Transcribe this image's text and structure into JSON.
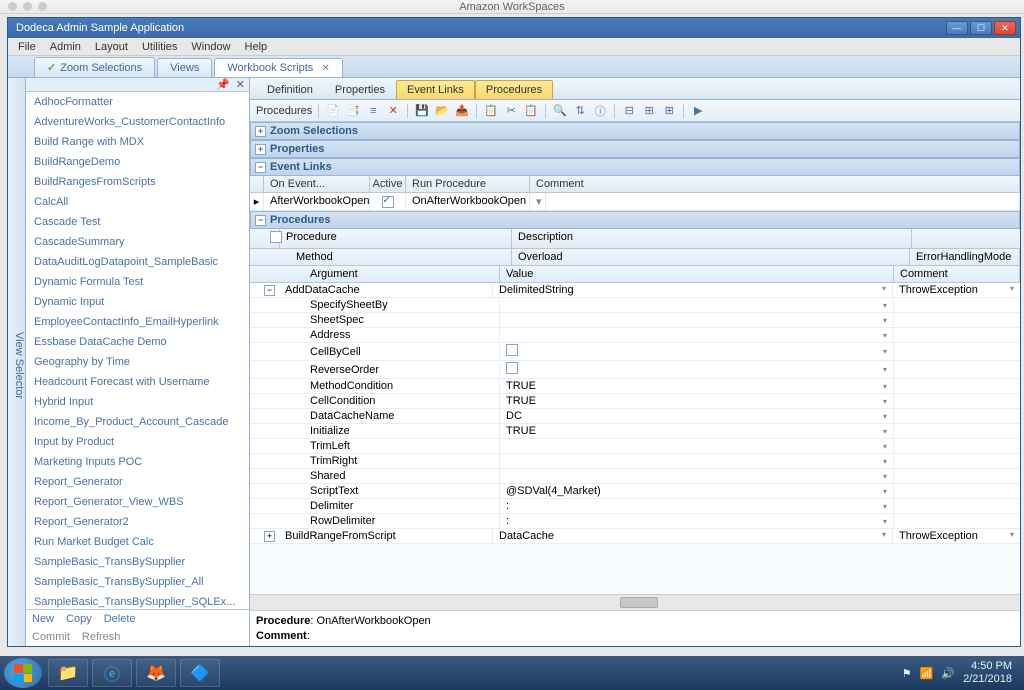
{
  "mac_title": "Amazon WorkSpaces",
  "app_title": "Dodeca Admin Sample Application",
  "menu": [
    "File",
    "Admin",
    "Layout",
    "Utilities",
    "Window",
    "Help"
  ],
  "tabs": [
    {
      "label": "Zoom Selections",
      "check": true
    },
    {
      "label": "Views"
    },
    {
      "label": "Workbook Scripts",
      "active": true,
      "closable": true
    }
  ],
  "view_selector_label": "View Selector",
  "left_list": [
    "AdhocFormatter",
    "AdventureWorks_CustomerContactInfo",
    "Build Range with MDX",
    "BuildRangeDemo",
    "BuildRangesFromScripts",
    "CalcAll",
    "Cascade Test",
    "CascadeSummary",
    "DataAuditLogDatapoint_SampleBasic",
    "Dynamic Formula Test",
    "Dynamic Input",
    "EmployeeContactInfo_EmailHyperlink",
    "Essbase DataCache Demo",
    "Geography by Time",
    "Headcount Forecast with Username",
    "Hybrid Input",
    "Income_By_Product_Account_Cascade",
    "Input by Product",
    "Marketing Inputs POC",
    "Report_Generator",
    "Report_Generator_View_WBS",
    "Report_Generator2",
    "Run Market Budget Calc",
    "SampleBasic_TransBySupplier",
    "SampleBasic_TransBySupplier_All",
    "SampleBasic_TransBySupplier_SQLEx..."
  ],
  "left_btns1": [
    "New",
    "Copy",
    "Delete"
  ],
  "left_btns2": [
    "Commit",
    "Refresh"
  ],
  "sub_tabs": [
    "Definition",
    "Properties",
    "Event Links",
    "Procedures"
  ],
  "toolbar_label": "Procedures",
  "sections": {
    "zoom": "Zoom Selections",
    "props": "Properties",
    "events": "Event Links",
    "procs": "Procedures"
  },
  "event_headers": {
    "on_event": "On Event...",
    "active": "Active",
    "run_proc": "Run Procedure",
    "comment": "Comment"
  },
  "event_row": {
    "on_event": "AfterWorkbookOpen",
    "active": true,
    "run_proc": "OnAfterWorkbookOpen",
    "comment": ""
  },
  "proc_headers": {
    "procedure": "Procedure",
    "description": "Description",
    "method": "Method",
    "overload": "Overload",
    "mode": "ErrorHandlingMode",
    "argument": "Argument",
    "value": "Value",
    "comment": "Comment"
  },
  "proc_rows": [
    {
      "name": "AddDataCache",
      "overload": "DelimitedString",
      "mode": "ThrowException",
      "expanded": true,
      "args": [
        {
          "name": "SpecifySheetBy",
          "value": ""
        },
        {
          "name": "SheetSpec",
          "value": ""
        },
        {
          "name": "Address",
          "value": ""
        },
        {
          "name": "CellByCell",
          "value": "",
          "checkbox": true
        },
        {
          "name": "ReverseOrder",
          "value": "",
          "checkbox": true
        },
        {
          "name": "MethodCondition",
          "value": "TRUE"
        },
        {
          "name": "CellCondition",
          "value": "TRUE"
        },
        {
          "name": "DataCacheName",
          "value": "DC"
        },
        {
          "name": "Initialize",
          "value": "TRUE"
        },
        {
          "name": "TrimLeft",
          "value": ""
        },
        {
          "name": "TrimRight",
          "value": ""
        },
        {
          "name": "Shared",
          "value": ""
        },
        {
          "name": "ScriptText",
          "value": "@SDVal(4_Market)"
        },
        {
          "name": "Delimiter",
          "value": ":"
        },
        {
          "name": "RowDelimiter",
          "value": ":"
        }
      ]
    },
    {
      "name": "BuildRangeFromScript",
      "overload": "DataCache",
      "mode": "ThrowException",
      "expanded": false
    }
  ],
  "status": {
    "proc_label": "Procedure",
    "proc_val": "OnAfterWorkbookOpen",
    "comment_label": "Comment",
    "comment_val": ""
  },
  "tray": {
    "time": "4:50 PM",
    "date": "2/21/2018"
  }
}
